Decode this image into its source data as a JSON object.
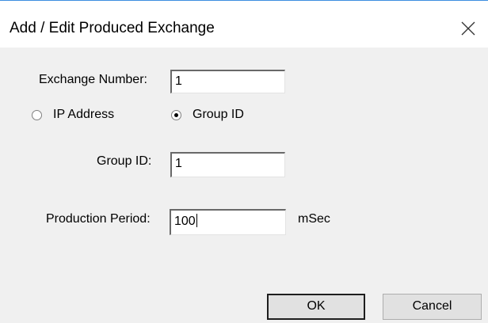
{
  "dialog": {
    "title": "Add / Edit Produced Exchange",
    "exchange_number_label": "Exchange Number:",
    "exchange_number_value": "1",
    "radio_ip_label": "IP Address",
    "radio_group_label": "Group ID",
    "selected_radio": "Group ID",
    "group_id_label": "Group ID:",
    "group_id_value": "1",
    "production_period_label": "Production Period:",
    "production_period_value": "100",
    "production_period_unit": "mSec",
    "ok_label": "OK",
    "cancel_label": "Cancel"
  },
  "icons": {
    "close": "close-icon"
  },
  "colors": {
    "accent_line": "#3d8ee0",
    "background": "#f0f0f0",
    "titlebar": "#ffffff"
  }
}
